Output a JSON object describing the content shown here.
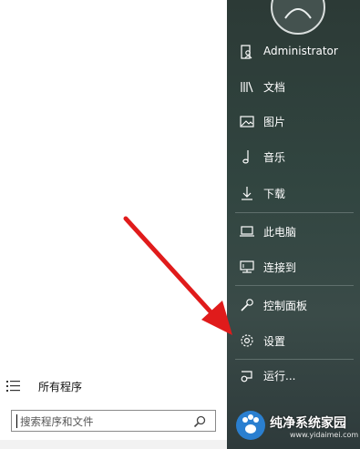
{
  "programs_pane": {
    "all_programs_label": "所有程序",
    "search_placeholder": "搜索程序和文件"
  },
  "right_menu": {
    "items": [
      {
        "label": "Administrator",
        "icon": "user-document-icon"
      },
      {
        "label": "文档",
        "icon": "library-icon"
      },
      {
        "label": "图片",
        "icon": "picture-icon"
      },
      {
        "label": "音乐",
        "icon": "music-note-icon"
      },
      {
        "label": "下载",
        "icon": "download-arrow-icon"
      },
      {
        "label": "此电脑",
        "icon": "laptop-icon"
      },
      {
        "label": "连接到",
        "icon": "network-monitor-icon"
      },
      {
        "label": "控制面板",
        "icon": "wrench-icon"
      },
      {
        "label": "设置",
        "icon": "gear-icon"
      },
      {
        "label": "运行...",
        "icon": "run-icon"
      }
    ]
  },
  "watermark": {
    "title": "纯净系统家园",
    "url": "www.yidaimei.com"
  },
  "colors": {
    "annotation_arrow": "#e01b1b",
    "menu_text": "#ffffff",
    "sidebar_bg": "#314540"
  }
}
